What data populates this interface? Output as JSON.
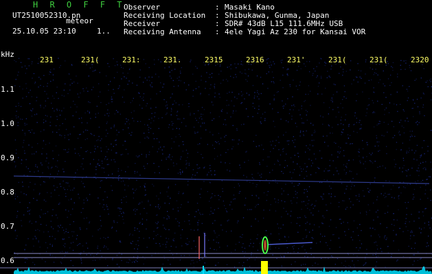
{
  "header": {
    "app_name": "H R O F F T",
    "filename": "UT2510052310.pn",
    "meteor_label": "meteor",
    "datetime": "25.10.05 23:10",
    "count": "1..",
    "info": [
      {
        "label": "Observer",
        "value": "Masaki Kano"
      },
      {
        "label": "Receiving Location",
        "value": "Shibukawa, Gunma, Japan"
      },
      {
        "label": "Receiver",
        "value": "SDR# 43dB L15 111.6MHz USB"
      },
      {
        "label": "Receiving Antenna",
        "value": "4ele Yagi Az 230 for Kansai VOR"
      }
    ],
    "colon": ":"
  },
  "spectrogram": {
    "freq_unit": "kHz",
    "freq_ticks": [
      "1.1",
      "1.0",
      "0.9",
      "0.8",
      "0.7",
      "0.6"
    ],
    "time_ticks": [
      "231",
      "231(",
      "231:",
      "231.",
      "2315",
      "2316",
      "231'",
      "231(",
      "231(",
      "2320"
    ],
    "colors": {
      "background": "#000000",
      "noise": "#1a2a8a",
      "carrier": "#3a4ab0",
      "meteor_green": "#4cff4c",
      "meteor_yellow": "#ffff00",
      "baseline": "#00e0ff",
      "ref_line": "#b0b0ff"
    }
  }
}
